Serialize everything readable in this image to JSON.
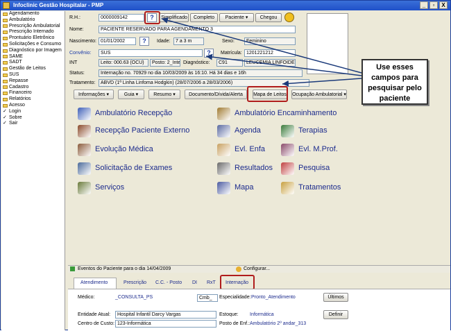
{
  "window": {
    "title": "Infoclinic Gestão Hospitalar - PMP",
    "buttons": [
      "_",
      "▫",
      "X"
    ]
  },
  "sidebar": {
    "items": [
      {
        "label": "Agendamento",
        "icon": "folder"
      },
      {
        "label": "Ambulatório",
        "icon": "folder"
      },
      {
        "label": "Prescrição Ambulatorial",
        "icon": "folder"
      },
      {
        "label": "Prescrição Internado",
        "icon": "folder"
      },
      {
        "label": "Prontuário Eletrônico",
        "icon": "folder"
      },
      {
        "label": "Solicitações e Consumo",
        "icon": "folder"
      },
      {
        "label": "Diagnóstico por Imagem",
        "icon": "folder"
      },
      {
        "label": "SAME",
        "icon": "folder"
      },
      {
        "label": "SADT",
        "icon": "folder"
      },
      {
        "label": "Gestão de Leitos",
        "icon": "folder"
      },
      {
        "label": "SUS",
        "icon": "folder"
      },
      {
        "label": "Repasse",
        "icon": "folder"
      },
      {
        "label": "Cadastro",
        "icon": "folder"
      },
      {
        "label": "Financeiro",
        "icon": "folder"
      },
      {
        "label": "Relatórios",
        "icon": "folder"
      },
      {
        "label": "Acesso",
        "icon": "folder"
      },
      {
        "label": "Login",
        "icon": "check"
      },
      {
        "label": "Sobre",
        "icon": "check"
      },
      {
        "label": "Sair",
        "icon": "check"
      }
    ]
  },
  "form": {
    "rh_label": "R.H.:",
    "rh_value": "0000009142",
    "q": "?",
    "btn_simplificado": "Simplificado",
    "btn_completo": "Completo",
    "btn_paciente": "Paciente ▾",
    "btn_chegou": "Chegou",
    "nome_label": "Nome:",
    "nome_value": "PACIENTE RESERVADO PARA AGENDAMENTO 3",
    "nasc_label": "Nascimento:",
    "nasc_value": "01/01/2002",
    "idade_label": "Idade:",
    "idade_value": "7 a 3 m",
    "sexo_label": "Sexo:",
    "sexo_value": "Feminino",
    "convenio_label": "Convênio:",
    "convenio_value": "SUS",
    "matricula_label": "Matrícula:",
    "matricula_value": "1201221212",
    "int_label": "INT",
    "leito_value": "Leito: 000.63 (OCU)",
    "posto_value": "Posto: 2_Inte",
    "diag_label": "Diagnóstico:",
    "diag_code": "C91",
    "diag_desc": "LEUCEMIA LINFOIDE",
    "status_label": "Status:",
    "status_value": "Internação no. 70929 no dia 10/03/2009  às  16:10. Há 34 dias e 16h",
    "trat_label": "Tratamento:",
    "trat_value": "ABVD (1ª Linha Linfoma Hodgkin) (28/07/2006 a 28/03/2006)"
  },
  "menus": [
    "Informações ▾",
    "Guia ▾",
    "Resumo ▾",
    "Documento/Dívida/Alerta",
    "Mapa de Leitos",
    "Ocupação Ambulatorial ▾"
  ],
  "modules": [
    {
      "label": "Ambulatório Recepção",
      "icon": "clinic-icon",
      "color": "#3e5fb8"
    },
    {
      "label": "Ambulatório Encaminhamento",
      "icon": "referral-icon",
      "color": "#a07a30"
    },
    {
      "label": "Recepção Paciente Externo",
      "icon": "reception-icon",
      "color": "#8a4a2a"
    },
    {
      "label": "Agenda",
      "icon": "calendar-icon",
      "color": "#5a6aa0"
    },
    {
      "label": "Terapias",
      "icon": "therapy-icon",
      "color": "#3a7a3a"
    },
    {
      "label": "Evolução Médica",
      "icon": "books-icon",
      "color": "#8a5a3a"
    },
    {
      "label": "Evl. Enfa",
      "icon": "nurse-icon",
      "color": "#c8a060"
    },
    {
      "label": "Evl. M.Prof.",
      "icon": "pen-icon",
      "color": "#8a4a6a"
    },
    {
      "label": "Solicitação de Exames",
      "icon": "exam-icon",
      "color": "#4a6a9a"
    },
    {
      "label": "Resultados",
      "icon": "results-icon",
      "color": "#6a6a6a"
    },
    {
      "label": "Pesquisa",
      "icon": "search-icon",
      "color": "#c04040"
    },
    {
      "label": "Serviços",
      "icon": "services-icon",
      "color": "#6a7a3a"
    },
    {
      "label": "Mapa",
      "icon": "map-icon",
      "color": "#4a5aa0"
    },
    {
      "label": "Tratamentos",
      "icon": "treatment-icon",
      "color": "#c8a040"
    }
  ],
  "events": {
    "label": "Eventos do Paciente para o dia 14/04/2009",
    "config": "Configurar..."
  },
  "tabs": [
    "Atendimento",
    "Prescrição",
    "C.C. - Posto",
    "DI",
    "RxT",
    "Internação"
  ],
  "bottom": {
    "medico_label": "Médico:",
    "medico_value": "_CONSULTA_PS",
    "cmb_value": "Cmb_",
    "esp_label": "Especialidade:",
    "esp_value": "Pronto_Atendimento",
    "ultimos": "Últimos",
    "entidade_label": "Entidade Atual:",
    "entidade_value": "Hospital Infantil Darcy Vargas",
    "estoque_label": "Estoque:",
    "estoque_value": "Informática",
    "definir": "Definir",
    "cc_label": "Centro de Custo:",
    "cc_value": "123-Informática",
    "posto_label": "Posto de Enf.:",
    "posto_value": "Ambulatório 2º andar_313"
  },
  "callout": {
    "text": "Use esses campos para pesquisar pelo paciente"
  }
}
